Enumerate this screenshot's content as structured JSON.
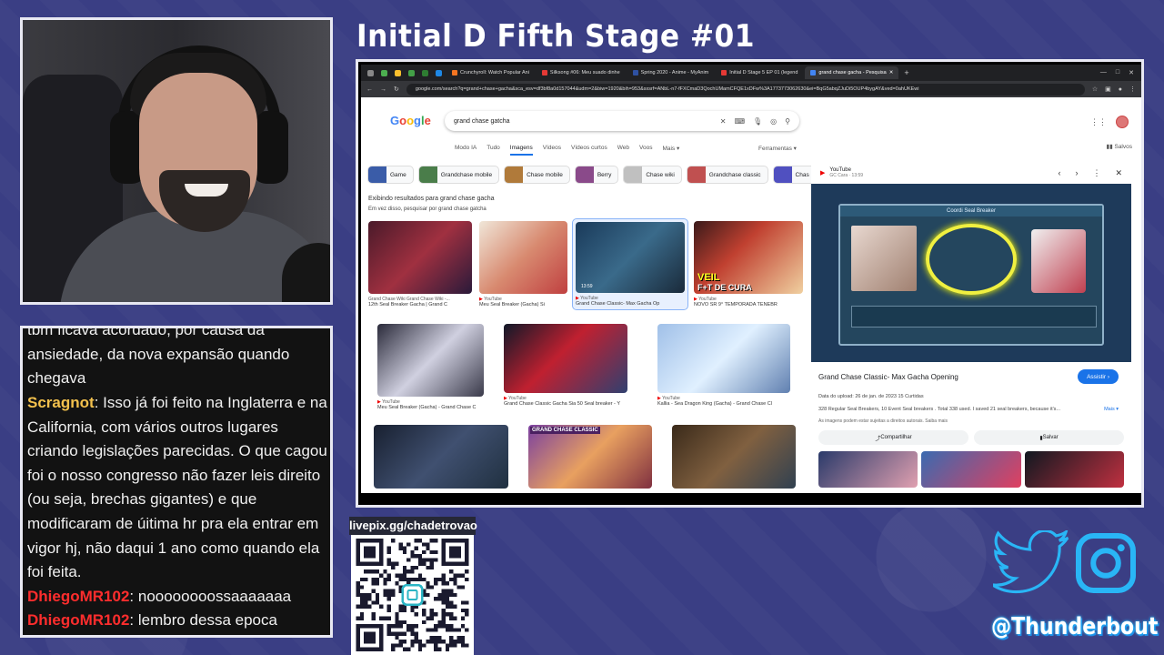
{
  "stream": {
    "title": "Initial D Fifth Stage #01",
    "livepix_label": "livepix.gg/chadetrovao",
    "social_handle": "@Thunderbout"
  },
  "chat": {
    "messages": [
      {
        "user": "",
        "text": "tbm ficava acordado, por causa da"
      },
      {
        "user": "",
        "text": "ansiedade, da nova expansão quando"
      },
      {
        "user": "",
        "text": "chegava"
      },
      {
        "user": "Scragnot",
        "text": ": Isso já foi feito na Inglaterra e na"
      },
      {
        "user": "",
        "text": "California, com vários outros lugares"
      },
      {
        "user": "",
        "text": "criando legislações parecidas. O que cagou"
      },
      {
        "user": "",
        "text": "foi o nosso congresso não fazer leis direito"
      },
      {
        "user": "",
        "text": "(ou seja, brechas gigantes) e que"
      },
      {
        "user": "",
        "text": "modificaram de úitima hr pra ela entrar em"
      },
      {
        "user": "",
        "text": "vigor hj, não daqui 1 ano como quando ela"
      },
      {
        "user": "",
        "text": "foi feita."
      },
      {
        "user": "DhiegoMR102",
        "text": ": noooooooossaaaaaaa"
      },
      {
        "user": "DhiegoMR102",
        "text": ": lembro dessa epoca"
      }
    ]
  },
  "browser": {
    "tabs": [
      "Crunchyroll: Watch Popular Ani",
      "Silksong #06: Meu suado dinhe",
      "Spring 2020 - Anime - MyAnim",
      "Initial D Stage 5 EP 01 (legend",
      "grand chase gacha - Pesquisa"
    ],
    "url": "google.com/search?q=grand+chase+gacha&sca_esv=df3bf8a0d157044&udm=2&biw=1920&bih=953&sxsrf=ANbL-n7-fFXCmaD3QochUMamCFQE1xDFw%3A1773773062630&ei=BqG5abqZJuDi5OUP4bygAY&ved=0ahUKEwi",
    "search_query": "grand chase gatcha",
    "search_tabs": [
      "Modo IA",
      "Tudo",
      "Imagens",
      "Vídeos",
      "Vídeos curtos",
      "Web",
      "Voos",
      "Mais ▾"
    ],
    "active_tab": "Imagens",
    "tools_label": "Ferramentas ▾",
    "saved_label": "Salvos",
    "chips": [
      "Game",
      "Grandchase mobile",
      "Chase mobile",
      "Berry",
      "Chase wiki",
      "Grandchase classic",
      "Chas"
    ],
    "results_note": "Exibindo resultados para grand chase gacha",
    "results_note_bold": "gacha",
    "results_note2": "Em vez disso, pesquisar por grand chase gatcha",
    "images": [
      {
        "src": "Grand Chase Wiki Grand Chase Wiki -...",
        "cap": "12th Seal Breaker Gacha | Grand C"
      },
      {
        "src": "YouTube",
        "cap": "Meu Seal Breaker (Gacha) Si"
      },
      {
        "src": "YouTube",
        "cap": "Grand Chase Classic- Max Gacha Op"
      },
      {
        "src": "YouTube",
        "cap": "NOVO SR 9° TEMPORADA TENEBR"
      },
      {
        "src": "YouTube",
        "cap": "Meu Seal Breaker (Gacha) - Grand Chase C"
      },
      {
        "src": "YouTube",
        "cap": "Grand Chase Classic Gacha Sia 50 Seal breaker - Y"
      },
      {
        "src": "YouTube",
        "cap": "Kallia - Sea Dragon King (Gacha) - Grand Chase Cl"
      }
    ],
    "video_duration": "13:59",
    "panel": {
      "source": "YouTube",
      "channel": "GC Cara · 13:59",
      "title": "Grand Chase Classic- Max Gacha Opening",
      "visit_button": "Assistir ›",
      "meta": "Data do upload: 26 de jan. de 2023      15 Curtidas",
      "desc": "328 Regular Seal Breakers, 10 Event Seal breakers . Total 338 used. I saved 21 seal breakers, because it's...",
      "more": "Mais ▾",
      "rights": "As imagens podem estar sujeitas a direitos autorais. Saiba mais",
      "share": "Compartilhar",
      "save": "Salvar",
      "ingame_title": "Coordi Seal Breaker"
    },
    "chip_watermark": "CHASE CLASSIC",
    "veil_text": "VEIL",
    "cura_text": "F+T DE CURA",
    "gc_classic_text": "GRAND CHASE CLASSIC"
  },
  "colors": {
    "background": "#3a3e84",
    "frame": "#e8e8f2",
    "chat_user_yellow": "#f3c14d",
    "chat_user_red": "#ff2d2d",
    "handle_glow": "#29b6f6"
  }
}
